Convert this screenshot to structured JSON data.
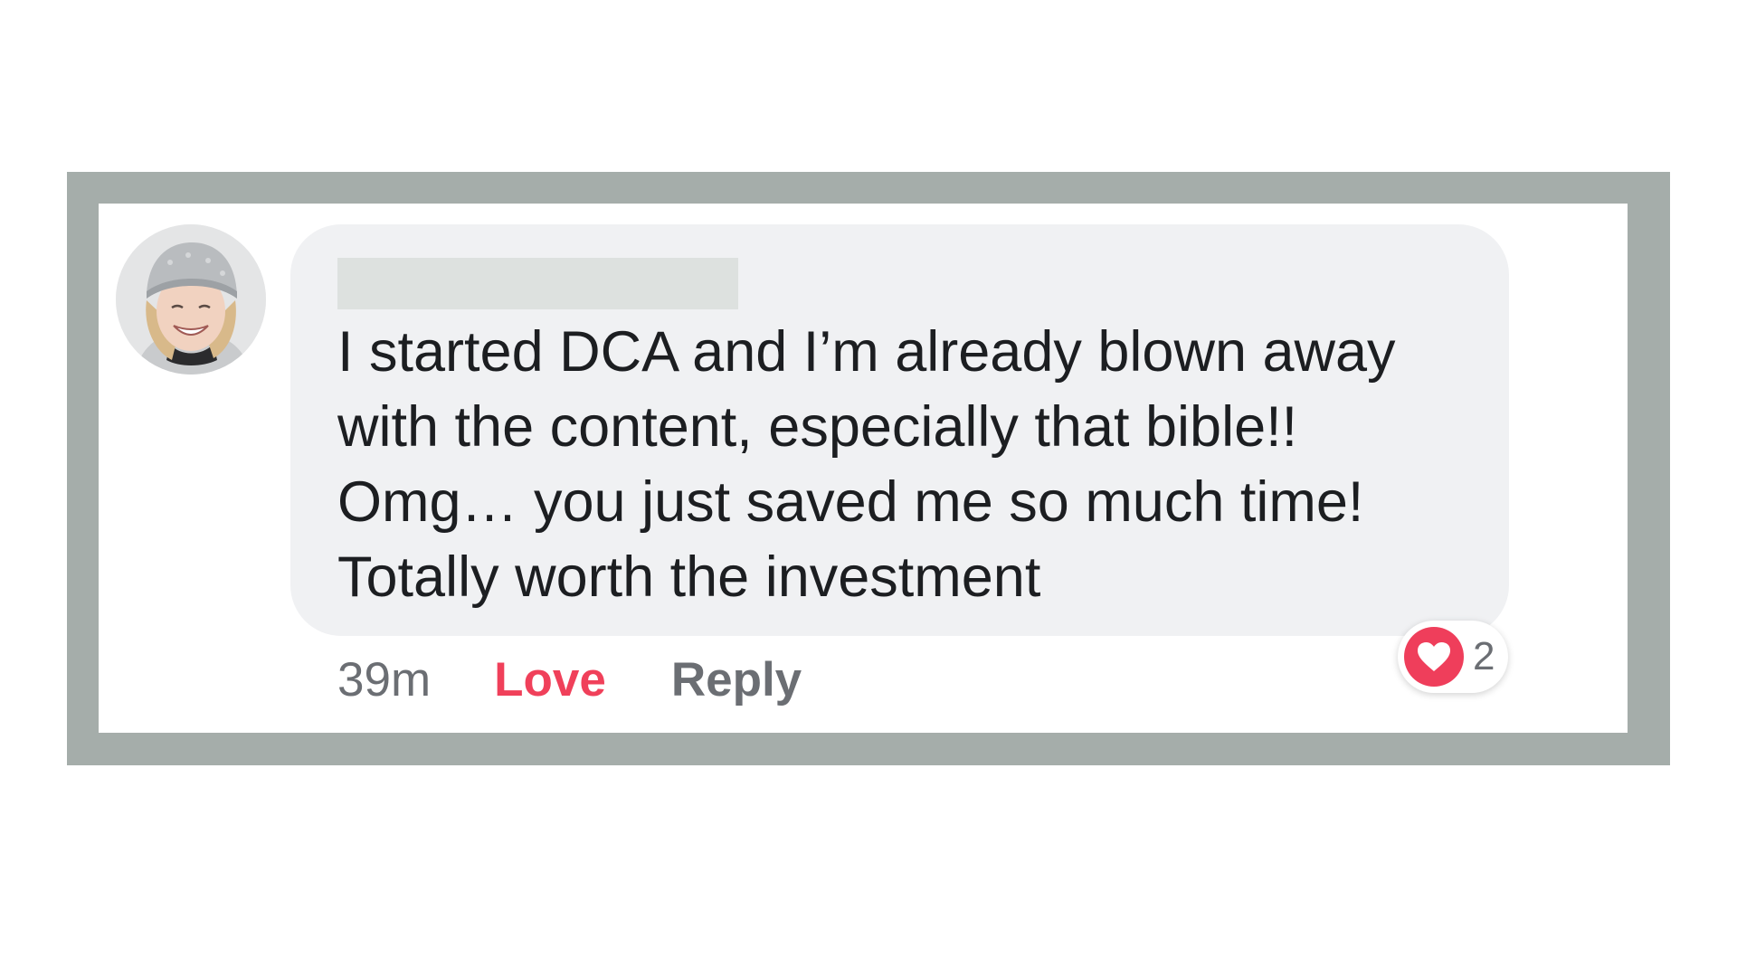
{
  "comment": {
    "text": "I started DCA and I’m already blown away\nwith the content, especially that bible!!\nOmg… you just saved me so much time!\nTotally worth the investment",
    "timestamp": "39m",
    "love_label": "Love",
    "reply_label": "Reply"
  },
  "reaction": {
    "icon": "heart-icon",
    "count": "2",
    "color": "#ef3e5b"
  },
  "colors": {
    "frame": "#a5adaa",
    "bubble": "#f0f1f3",
    "love_action": "#f0405a"
  }
}
